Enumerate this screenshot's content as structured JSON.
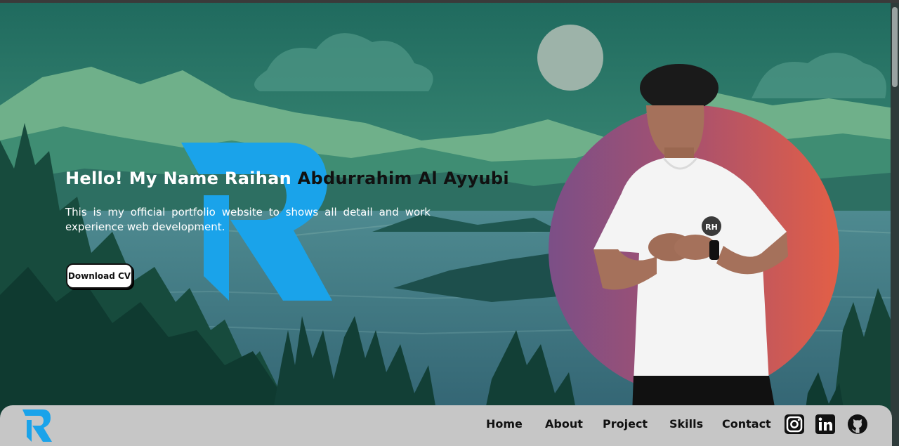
{
  "hero": {
    "greeting_white": "Hello! My Name Raihan",
    "greeting_dark": "Abdurrahim Al Ayyubi",
    "subtitle": "This is my official portfolio website to shows all detail and work experience web development.",
    "download_cv_label": "Download CV"
  },
  "nav": {
    "links": [
      "Home",
      "About",
      "Project",
      "Skills",
      "Contact"
    ],
    "social_icons": [
      "instagram-icon",
      "linkedin-icon",
      "github-icon"
    ]
  },
  "badge": {
    "shirt_logo": "RH"
  },
  "colors": {
    "accent_blue": "#1aa3ea",
    "circle_start": "#7b4f87",
    "circle_end": "#e35f46",
    "navbar_bg": "#c6c6c6"
  }
}
